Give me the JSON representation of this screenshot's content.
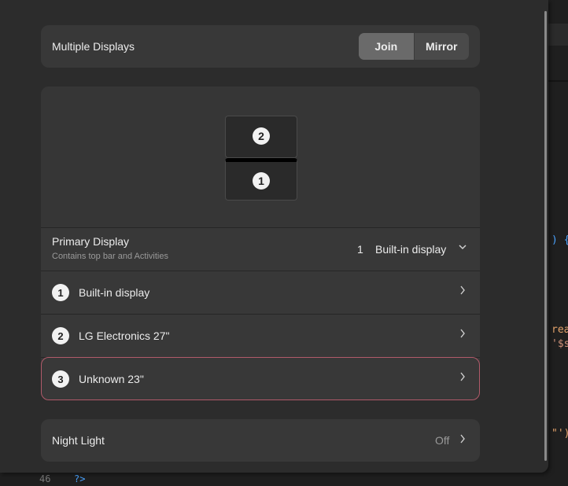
{
  "multiple_displays": {
    "label": "Multiple Displays",
    "options": [
      "Join",
      "Mirror"
    ],
    "selected": "Join"
  },
  "arrangement": {
    "monitors": [
      "2",
      "1"
    ]
  },
  "primary_display": {
    "title": "Primary Display",
    "subtitle": "Contains top bar and Activities",
    "selected_number": "1",
    "selected_name": "Built-in display"
  },
  "displays": [
    {
      "number": "1",
      "name": "Built-in display"
    },
    {
      "number": "2",
      "name": "LG Electronics 27\""
    },
    {
      "number": "3",
      "name": "Unknown 23\""
    }
  ],
  "night_light": {
    "label": "Night Light",
    "value": "Off"
  },
  "background_editor": {
    "fragments": [
      ") {",
      "rea",
      "'$s",
      "\"')"
    ],
    "line_number": "46",
    "code": "?>"
  },
  "colors": {
    "accent_highlight": "#b05a6a",
    "window_bg": "#2c2c2c",
    "card_bg": "#383838"
  }
}
